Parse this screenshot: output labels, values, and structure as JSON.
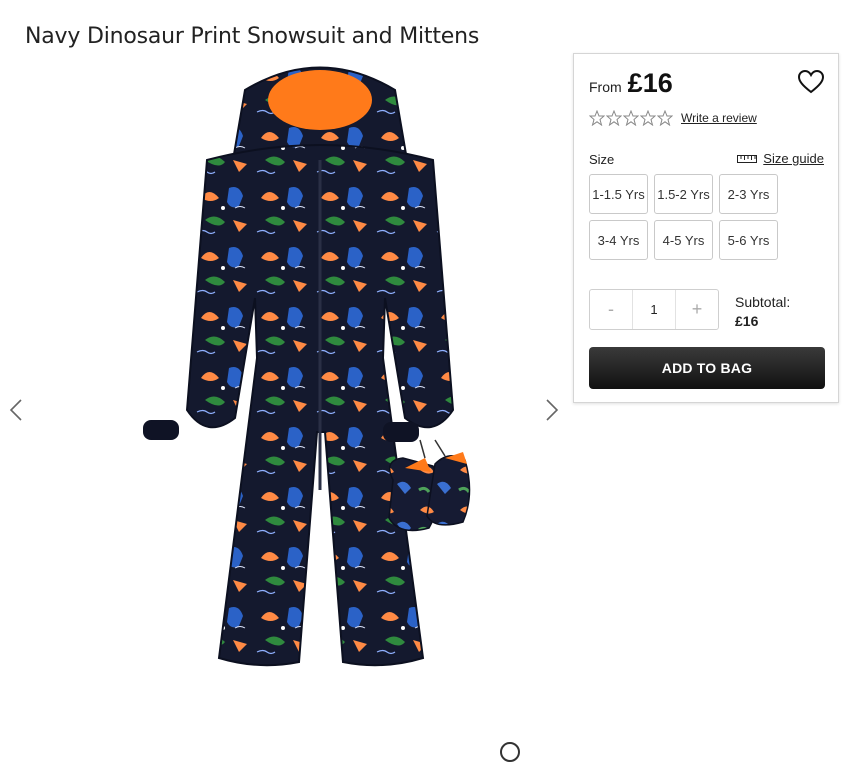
{
  "product": {
    "title": "Navy Dinosaur Print Snowsuit and Mittens",
    "image_alt": "Navy dinosaur print snowsuit with orange hood lining and matching mittens"
  },
  "gallery": {
    "prev_icon": "chevron-left-icon",
    "next_icon": "chevron-right-icon"
  },
  "pricing": {
    "from_label": "From",
    "price": "£16"
  },
  "rating": {
    "stars_filled": 0,
    "stars_total": 5,
    "write_review_label": "Write a review"
  },
  "size": {
    "label": "Size",
    "guide_label": "Size guide",
    "options": [
      "1-1.5 Yrs",
      "1.5-2 Yrs",
      "2-3 Yrs",
      "3-4 Yrs",
      "4-5 Yrs",
      "5-6 Yrs"
    ]
  },
  "quantity": {
    "minus_label": "-",
    "value": "1",
    "plus_label": "+"
  },
  "subtotal": {
    "label": "Subtotal:",
    "amount": "£16"
  },
  "add_to_bag_label": "ADD TO BAG",
  "colors": {
    "navy": "#14192e",
    "orange": "#ff7a1a",
    "button_dark": "#1a1a1a"
  }
}
